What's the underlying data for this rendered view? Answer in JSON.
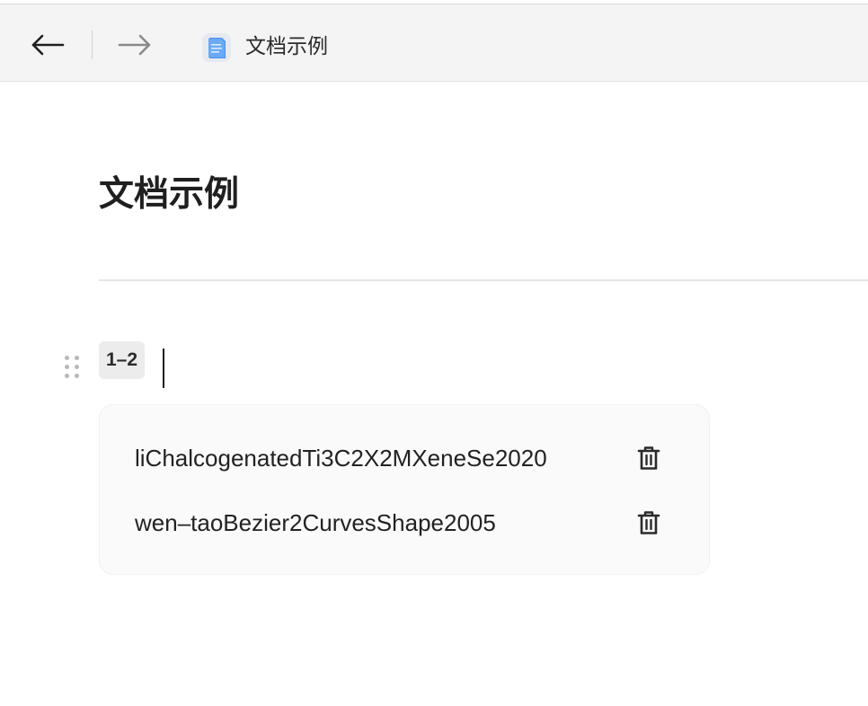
{
  "toolbar": {
    "back_icon": "arrow-left-icon",
    "forward_icon": "arrow-right-icon",
    "doc_icon": "document-icon",
    "title": "文档示例"
  },
  "page": {
    "title": "文档示例"
  },
  "block": {
    "badge": "1–2",
    "handle_icon": "drag-handle-icon",
    "items": [
      {
        "label": "liChalcogenatedTi3C2X2MXeneSe2020",
        "delete_icon": "trash-icon"
      },
      {
        "label": "wen–taoBezier2CurvesShape2005",
        "delete_icon": "trash-icon"
      }
    ]
  },
  "colors": {
    "toolbar_bg": "#f4f4f4",
    "card_bg": "#fafafa",
    "badge_bg": "#ececec",
    "text": "#1f1f1f",
    "forward_disabled": "#8a8a8a"
  }
}
